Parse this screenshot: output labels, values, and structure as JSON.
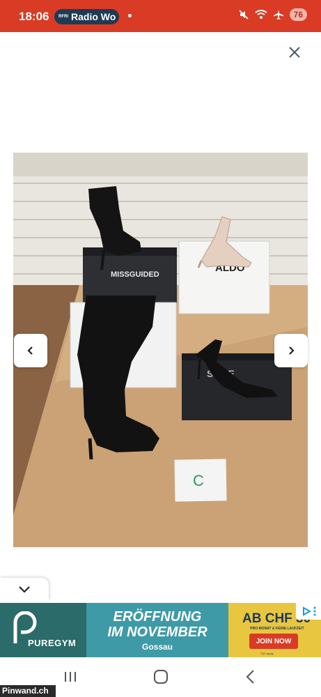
{
  "status_bar": {
    "time": "18:06",
    "radio_logo": "RFRI",
    "radio_name": "Radio Wo",
    "battery": "76",
    "icons": [
      "mute-icon",
      "wifi-icon",
      "airplane-icon"
    ],
    "background_color": "#d93b25"
  },
  "viewer": {
    "close_icon": "close-icon",
    "prev_icon": "chevron-left-icon",
    "next_icon": "chevron-right-icon",
    "photo_label": "C",
    "photo_box_labels": [
      "MISSGUIDED",
      "ALDO",
      "SHOE"
    ]
  },
  "collapse": {
    "icon": "chevron-down-icon"
  },
  "ad": {
    "brand": "PUREGYM",
    "headline_line1": "ERÖFFNUNG",
    "headline_line2": "IM NOVEMBER",
    "city": "Gossau",
    "price": "AB CHF 30",
    "subline": "PRO MONAT & KEINE LAUFZEIT",
    "cta": "JOIN NOW",
    "fine_print": "T&C apply",
    "colors": {
      "teal_dark": "#2b6b69",
      "teal": "#3e9aa7",
      "yellow": "#e9c640",
      "red": "#d93b25"
    }
  },
  "nav_bar": {
    "recents_icon": "recents-icon",
    "home_icon": "home-icon",
    "back_icon": "back-icon"
  },
  "watermark": "Pinwand.ch"
}
